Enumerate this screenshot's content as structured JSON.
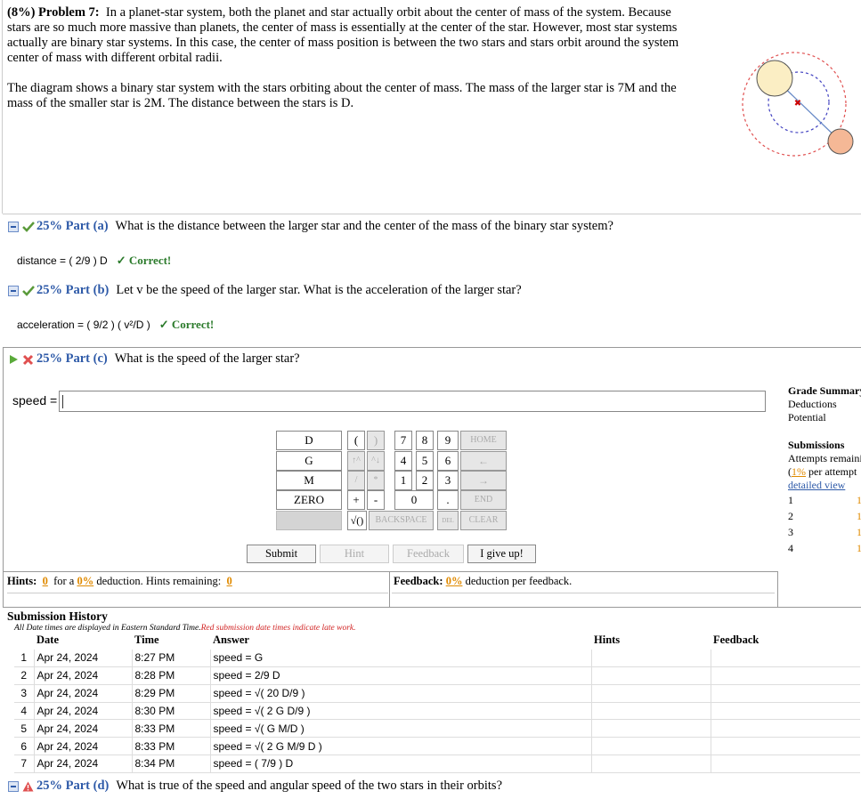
{
  "problem": {
    "header": "(8%) Problem 7:",
    "p1": "In a planet-star system, both the planet and star actually orbit about the center of mass of the system. Because stars are so much more massive than planets, the center of mass is essentially at the center of the star. However, most star systems actually are binary star systems. In this case, the center of mass position is between the two stars and stars orbit around the system center of mass with different orbital radii.",
    "p2": "The diagram shows a binary star system with the stars orbiting about the center of mass. The mass of the larger star is 7M and the mass of the smaller star is 2M. The distance between the stars is D."
  },
  "parts": {
    "a": {
      "pct": "25% Part (a)",
      "question": "What is the distance between the larger star and the center of the mass of the binary star system?",
      "answer": "distance = ( 2/9 ) D",
      "status": "✓ Correct!"
    },
    "b": {
      "pct": "25% Part (b)",
      "question": "Let v be the speed of the larger star. What is the acceleration of the larger star?",
      "answer": "acceleration = ( 9/2 ) ( v²/D )",
      "status": "✓ Correct!"
    },
    "c": {
      "pct": "25% Part (c)",
      "question": "What is the speed of the larger star?"
    },
    "d": {
      "pct": "25% Part (d)",
      "question": "What is true of the speed and angular speed of the two stars in their orbits?"
    }
  },
  "input": {
    "label": "speed =",
    "value": ""
  },
  "keypad": {
    "vars": [
      "D",
      "G",
      "M",
      "ZERO"
    ],
    "row1": [
      "(",
      ")",
      "7",
      "8",
      "9",
      "HOME"
    ],
    "row2": [
      "↑^",
      "^↓",
      "4",
      "5",
      "6",
      "←"
    ],
    "row3": [
      "/",
      "*",
      "1",
      "2",
      "3",
      "→"
    ],
    "row4": [
      "+",
      "-",
      "0",
      ".",
      "END"
    ],
    "row5": [
      "√()",
      "BACKSPACE",
      "DEL",
      "CLEAR"
    ]
  },
  "buttons": {
    "submit": "Submit",
    "hint": "Hint",
    "feedback": "Feedback",
    "give_up": "I give up!"
  },
  "grade": {
    "title": "Grade Summary",
    "deductions": "Deductions",
    "potential": "Potential",
    "submissions": "Submissions",
    "attempts": "Attempts remaining",
    "per_attempt_pct": "1%",
    "per_attempt": "per attempt",
    "detailed": "detailed view",
    "rows": [
      "1",
      "2",
      "3",
      "4"
    ],
    "row_vals": [
      "1",
      "1",
      "1",
      "1"
    ]
  },
  "hints": {
    "label": "Hints:",
    "pct": "0",
    "for_a": "for a",
    "ded_pct": "0%",
    "ded_text": "deduction. Hints remaining:",
    "remaining": "0"
  },
  "feedback": {
    "label": "Feedback:",
    "pct": "0%",
    "text": "deduction per feedback."
  },
  "history": {
    "title": "Submission History",
    "note": "All Date times are displayed in Eastern Standard Time.",
    "note_red": "Red submission date times indicate late work.",
    "columns": [
      "Date",
      "Time",
      "Answer",
      "Hints",
      "Feedback"
    ],
    "rows": [
      {
        "n": "1",
        "date": "Apr 24, 2024",
        "time": "8:27 PM",
        "answer": "speed = G"
      },
      {
        "n": "2",
        "date": "Apr 24, 2024",
        "time": "8:28 PM",
        "answer": "speed = 2/9 D"
      },
      {
        "n": "3",
        "date": "Apr 24, 2024",
        "time": "8:29 PM",
        "answer": "speed = √( 20 D/9 )"
      },
      {
        "n": "4",
        "date": "Apr 24, 2024",
        "time": "8:30 PM",
        "answer": "speed = √( 2 G D/9 )"
      },
      {
        "n": "5",
        "date": "Apr 24, 2024",
        "time": "8:33 PM",
        "answer": "speed = √( G M/D )"
      },
      {
        "n": "6",
        "date": "Apr 24, 2024",
        "time": "8:33 PM",
        "answer": "speed = √( 2 G M/9 D )"
      },
      {
        "n": "7",
        "date": "Apr 24, 2024",
        "time": "8:34 PM",
        "answer": "speed = ( 7/9 ) D"
      }
    ]
  },
  "colors": {
    "accent": "#2e5aa8",
    "correct": "#2a7a2a",
    "wrong": "#e05050",
    "orange": "#e08a00"
  },
  "icons": [
    "collapse-icon",
    "checkmark-icon",
    "expand-icon",
    "cross-icon",
    "warning-icon"
  ]
}
